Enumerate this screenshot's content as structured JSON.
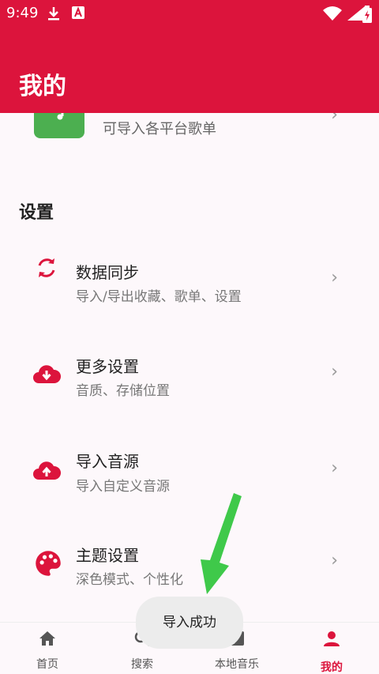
{
  "status_bar": {
    "time": "9:49",
    "icons": [
      "download-icon",
      "notification-a-icon",
      "wifi-icon",
      "battery-charging-icon"
    ]
  },
  "header": {
    "title": "我的",
    "background_color": "#dc143c"
  },
  "import_playlist": {
    "icon": "music-import-icon",
    "description": "可导入各平台歌单"
  },
  "settings": {
    "section_title": "设置",
    "items": [
      {
        "icon": "sync-icon",
        "title": "数据同步",
        "subtitle": "导入/导出收藏、歌单、设置"
      },
      {
        "icon": "cloud-download-icon",
        "title": "更多设置",
        "subtitle": "音质、存储位置"
      },
      {
        "icon": "cloud-upload-icon",
        "title": "导入音源",
        "subtitle": "导入自定义音源"
      },
      {
        "icon": "palette-icon",
        "title": "主题设置",
        "subtitle": "深色模式、个性化"
      }
    ]
  },
  "toast": {
    "text": "导入成功"
  },
  "bottom_nav": {
    "items": [
      {
        "icon": "home-icon",
        "label": "首页",
        "active": false
      },
      {
        "icon": "search-icon",
        "label": "搜索",
        "active": false
      },
      {
        "icon": "local-music-icon",
        "label": "本地音乐",
        "active": false
      },
      {
        "icon": "person-icon",
        "label": "我的",
        "active": true
      }
    ]
  },
  "colors": {
    "accent": "#dc143c",
    "import_tile": "#4caf50",
    "annotation_arrow": "#3fc94a"
  }
}
